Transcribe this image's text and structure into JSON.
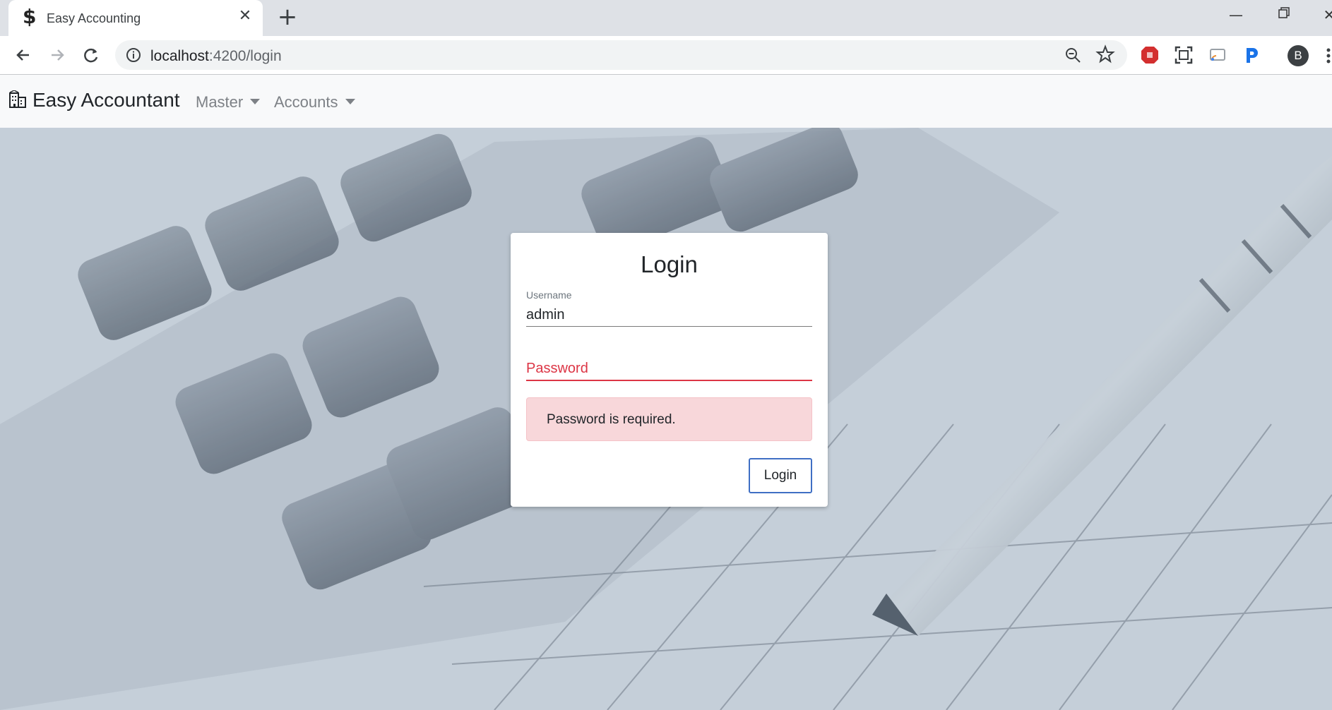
{
  "browser": {
    "tab_title": "Easy Accounting",
    "tab_favicon": "$",
    "url_host": "localhost",
    "url_rest": ":4200/login",
    "avatar_letter": "B"
  },
  "navbar": {
    "brand": "Easy Accountant",
    "items": [
      {
        "label": "Master"
      },
      {
        "label": "Accounts"
      }
    ]
  },
  "login": {
    "title": "Login",
    "username_label": "Username",
    "username_value": "admin",
    "password_placeholder": "Password",
    "error_message": "Password is required.",
    "submit_label": "Login"
  },
  "colors": {
    "error": "#dc3545",
    "alert_bg": "#f8d7da",
    "button_border": "#3f6fc4"
  }
}
